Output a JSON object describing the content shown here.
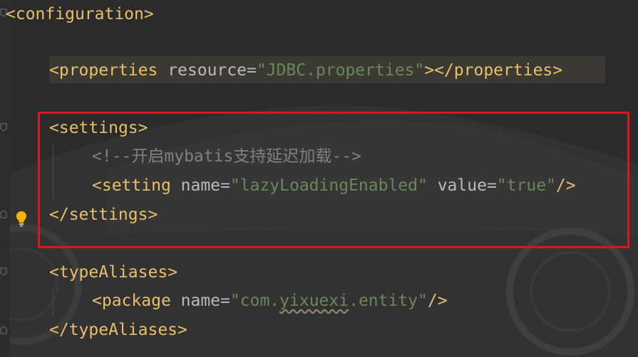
{
  "code": {
    "line1": {
      "open": "<",
      "name": "configuration",
      "close": ">"
    },
    "line2": {
      "open": "<",
      "name": "properties",
      "attr": " resource",
      "eq": "=",
      "value": "\"JDBC.properties\"",
      "gt": ">",
      "endTag": "</properties>"
    },
    "line3": {
      "open": "<",
      "name": "settings",
      "close": ">"
    },
    "line4": {
      "comment": "<!--开启mybatis支持延迟加载-->"
    },
    "line5": {
      "open": "<",
      "name": "setting",
      "attr1": " name",
      "eq1": "=",
      "value1": "\"lazyLoadingEnabled\"",
      "attr2": " value",
      "eq2": "=",
      "value2": "\"true\"",
      "close": "/>"
    },
    "line6": {
      "endTag": "</settings>"
    },
    "line7": {
      "open": "<",
      "name": "typeAliases",
      "close": ">"
    },
    "line8": {
      "open": "<",
      "name": "package",
      "attr": " name",
      "eq": "=",
      "value_q1": "\"",
      "value_a": "com.",
      "value_b": "yixuexi",
      "value_c": ".entity",
      "value_q2": "\"",
      "close": "/>"
    },
    "line9": {
      "endTag": "</typeAliases>"
    }
  },
  "colors": {
    "tag": "#e8bf6a",
    "attribute": "#bababa",
    "value": "#6a8759",
    "comment": "#808080",
    "highlight_border": "#e0141b",
    "background": "#2b2b2b"
  },
  "icons": {
    "intention": "lightbulb-icon",
    "fold": "fold-marker-icon"
  }
}
